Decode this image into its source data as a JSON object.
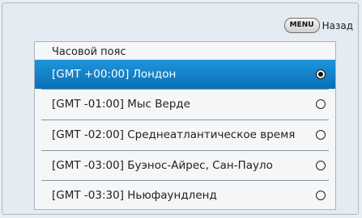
{
  "back": {
    "key_label": "MENU",
    "label": "Назад"
  },
  "dialog": {
    "title": "Часовой пояс",
    "options": [
      {
        "label": "[GMT +00:00] Лондон",
        "selected": true
      },
      {
        "label": "[GMT -01:00] Мыс Верде",
        "selected": false
      },
      {
        "label": "[GMT -02:00] Среднеатлантическое время",
        "selected": false
      },
      {
        "label": "[GMT -03:00] Буэнос-Айрес, Сан-Пауло",
        "selected": false
      },
      {
        "label": "[GMT -03:30] Ньюфаундленд",
        "selected": false
      }
    ]
  },
  "colors": {
    "selection": "#1580c8",
    "background": "#e4ebf2"
  }
}
